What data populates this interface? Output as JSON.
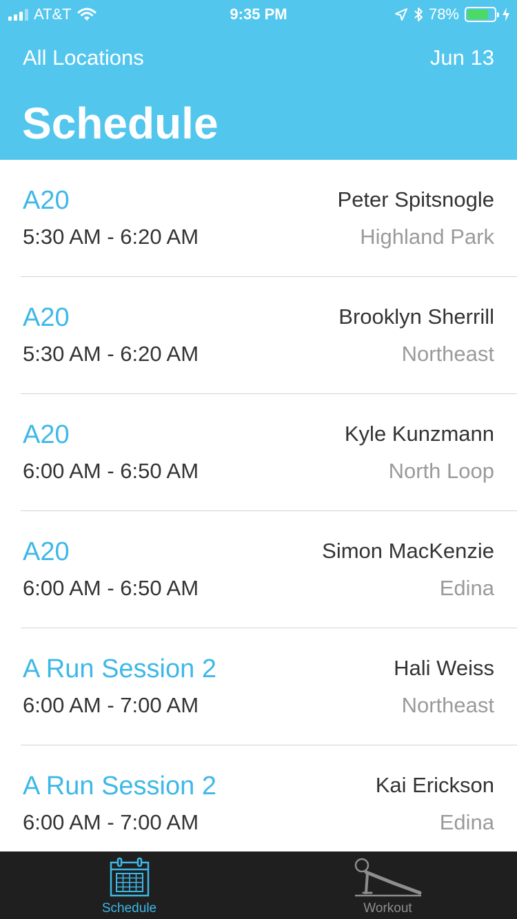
{
  "status_bar": {
    "carrier": "AT&T",
    "time": "9:35 PM",
    "battery_percent": "78%",
    "battery_level": 0.78,
    "icons": [
      "signal-icon",
      "wifi-icon",
      "location-arrow-icon",
      "bluetooth-icon",
      "battery-icon",
      "charging-icon"
    ]
  },
  "header": {
    "location_filter": "All Locations",
    "date": "Jun 13",
    "title": "Schedule"
  },
  "colors": {
    "header_bg": "#53c6ee",
    "accent": "#3db8e8",
    "tabbar_bg": "#1f1f1f",
    "muted_text": "#9a9a9a"
  },
  "schedule": [
    {
      "class_name": "A20",
      "time": "5:30 AM - 6:20 AM",
      "instructor": "Peter Spitsnogle",
      "location": "Highland Park"
    },
    {
      "class_name": "A20",
      "time": "5:30 AM - 6:20 AM",
      "instructor": "Brooklyn Sherrill",
      "location": "Northeast"
    },
    {
      "class_name": "A20",
      "time": "6:00 AM - 6:50 AM",
      "instructor": "Kyle Kunzmann",
      "location": "North Loop"
    },
    {
      "class_name": "A20",
      "time": "6:00 AM - 6:50 AM",
      "instructor": "Simon MacKenzie",
      "location": "Edina"
    },
    {
      "class_name": "A Run Session 2",
      "time": "6:00 AM - 7:00 AM",
      "instructor": "Hali Weiss",
      "location": "Northeast"
    },
    {
      "class_name": "A Run Session 2",
      "time": "6:00 AM - 7:00 AM",
      "instructor": "Kai Erickson",
      "location": "Edina"
    }
  ],
  "tabbar": {
    "tabs": [
      {
        "label": "Schedule",
        "icon": "calendar-icon",
        "active": true
      },
      {
        "label": "Workout",
        "icon": "pushup-icon",
        "active": false
      }
    ]
  }
}
